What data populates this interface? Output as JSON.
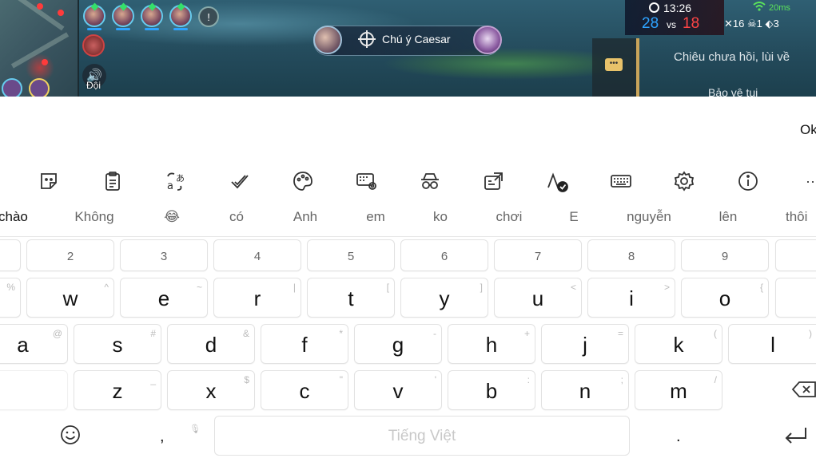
{
  "game": {
    "team_label": "Đội",
    "target_text": "Chú ý Caesar",
    "clock": "13:26",
    "score_blue": "28",
    "score_vs": "vs",
    "score_red": "18",
    "ping": "20ms",
    "stats": "✕16  ☠1  ⬖3",
    "chat_line_1": "Chiêu chưa hồi, lùi về",
    "chat_line_2": "Bảo vệ tui",
    "team_color": "#2ea3ff",
    "enemy_color": "#ff4545"
  },
  "input": {
    "typed_text": "Ok"
  },
  "toolbar": {
    "items": [
      {
        "name": "sticker-icon"
      },
      {
        "name": "clipboard-icon"
      },
      {
        "name": "translate-icon"
      },
      {
        "name": "checkmark-edit-icon"
      },
      {
        "name": "palette-icon"
      },
      {
        "name": "keyboard-settings-icon"
      },
      {
        "name": "incognito-icon"
      },
      {
        "name": "resize-icon"
      },
      {
        "name": "handwriting-icon"
      },
      {
        "name": "keyboard-icon"
      },
      {
        "name": "gear-icon"
      },
      {
        "name": "info-icon"
      }
    ],
    "more": "···"
  },
  "suggestions": [
    "chào",
    "Không",
    "😂",
    "có",
    "Anh",
    "em",
    "ko",
    "chơi",
    "E",
    "nguyễn",
    "lên",
    "thôi"
  ],
  "keyboard": {
    "numbers": [
      "2",
      "3",
      "4",
      "5",
      "6",
      "7",
      "8",
      "9"
    ],
    "row1": [
      {
        "key": "w",
        "sub": "^"
      },
      {
        "key": "e",
        "sub": "~"
      },
      {
        "key": "r",
        "sub": "|"
      },
      {
        "key": "t",
        "sub": "["
      },
      {
        "key": "y",
        "sub": "]"
      },
      {
        "key": "u",
        "sub": "<"
      },
      {
        "key": "i",
        "sub": ">"
      },
      {
        "key": "o",
        "sub": "{"
      }
    ],
    "row1_left_sub": "%",
    "row2": [
      {
        "key": "a",
        "sub": "@"
      },
      {
        "key": "s",
        "sub": "#"
      },
      {
        "key": "d",
        "sub": "&"
      },
      {
        "key": "f",
        "sub": "*"
      },
      {
        "key": "g",
        "sub": "-"
      },
      {
        "key": "h",
        "sub": "+"
      },
      {
        "key": "j",
        "sub": "="
      },
      {
        "key": "k",
        "sub": "("
      },
      {
        "key": "l",
        "sub": ")"
      }
    ],
    "row3": [
      {
        "key": "z",
        "sub": "_"
      },
      {
        "key": "x",
        "sub": "$"
      },
      {
        "key": "c",
        "sub": "\""
      },
      {
        "key": "v",
        "sub": "'"
      },
      {
        "key": "b",
        "sub": ":"
      },
      {
        "key": "n",
        "sub": ";"
      },
      {
        "key": "m",
        "sub": "/"
      }
    ],
    "comma": ",",
    "period": ".",
    "space_label": "Tiếng Việt"
  }
}
